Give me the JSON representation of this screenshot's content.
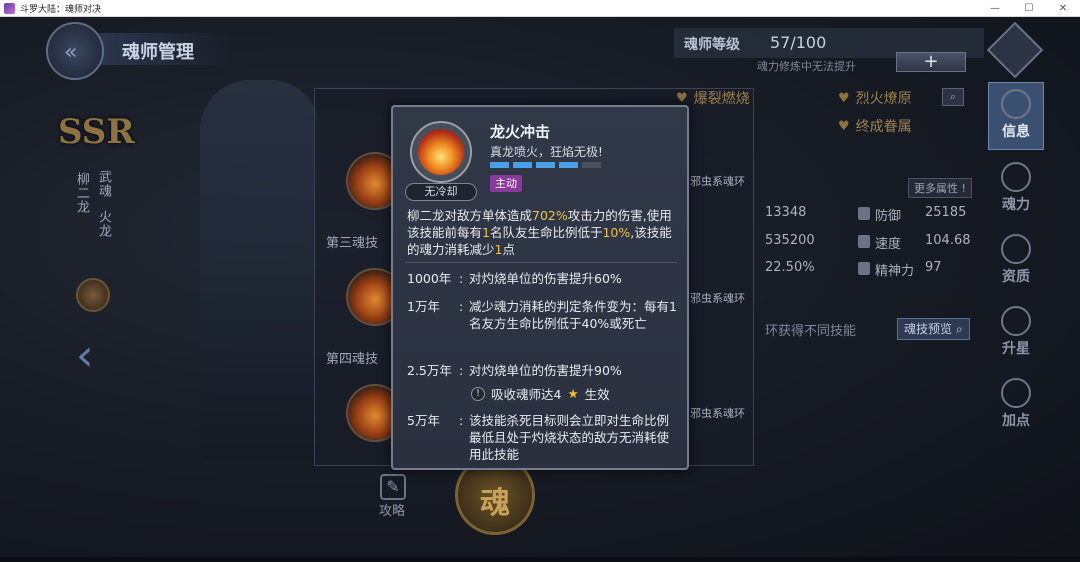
{
  "window": {
    "title": "斗罗大陆：魂师对决",
    "controls": [
      "—",
      "☐",
      "✕"
    ]
  },
  "header": {
    "title": "魂师管理"
  },
  "character": {
    "rarity": "SSR",
    "name": "柳二龙",
    "wuhun_label": "武魂",
    "wuhun_value": "火龙"
  },
  "skill_slots": [
    {
      "label": "第三魂技",
      "ring": "邪虫系魂环"
    },
    {
      "label": "第四魂技",
      "ring": "邪虫系魂环"
    },
    {
      "label": "",
      "ring": "邪虫系魂环"
    }
  ],
  "bottom": {
    "strategy_label": "攻略",
    "soul_glyph": "魂"
  },
  "level": {
    "label": "魂师等级",
    "value": "57/100",
    "hint": "魂力修炼中无法提升",
    "plus": "+"
  },
  "traits": [
    {
      "label": "爆裂燃烧"
    },
    {
      "label": "烈火燎原"
    },
    {
      "label": "终成眷属"
    }
  ],
  "more_attributes": "更多属性 !",
  "stats": [
    {
      "name": "",
      "value": "13348"
    },
    {
      "name": "防御",
      "value": "25185"
    },
    {
      "name": "",
      "value": "535200"
    },
    {
      "name": "速度",
      "value": "104.68"
    },
    {
      "name": "",
      "value": "22.50%"
    },
    {
      "name": "精神力",
      "value": "97"
    }
  ],
  "skill_hint": "环获得不同技能",
  "preview_button": "魂技预览",
  "side_menu": [
    {
      "label": "信息",
      "active": true
    },
    {
      "label": "魂力",
      "active": false
    },
    {
      "label": "资质",
      "active": false
    },
    {
      "label": "升星",
      "active": false
    },
    {
      "label": "加点",
      "active": false
    }
  ],
  "tooltip": {
    "skill_name": "龙火冲击",
    "tagline": "真龙喷火，狂焰无极!",
    "cooldown": "无冷却",
    "type": "主动",
    "level_bars": {
      "filled": 4,
      "total": 5
    },
    "desc_1": "柳二龙对敌方单体造成",
    "desc_pct": "702%",
    "desc_2": "攻击力的伤害,使用该技能前每有",
    "desc_n": "1",
    "desc_3": "名队友生命比例低于",
    "desc_thr": "10%",
    "desc_4": ",该技能的魂力消耗减少",
    "desc_red": "1",
    "desc_5": "点",
    "upgrades": [
      {
        "year": "1000年",
        "text": "对灼烧单位的伤害提升60%"
      },
      {
        "year": "1万年",
        "text": "减少魂力消耗的判定条件变为：每有1名友方生命比例低于40%或死亡"
      },
      {
        "year": "2.5万年",
        "text": "对灼烧单位的伤害提升90%"
      },
      {
        "year": "5万年",
        "text": "该技能杀死目标则会立即对生命比例最低且处于灼烧状态的敌方无消耗使用此技能"
      }
    ],
    "colon": ":",
    "condition_pre": "吸收魂师达4",
    "condition_post": "生效",
    "warn_glyph": "!",
    "star_glyph": "★"
  },
  "colors": {
    "highlight": "#f1c04a",
    "bar_fill": "#4aa0e8",
    "type_tag": "#8a3a9c"
  }
}
